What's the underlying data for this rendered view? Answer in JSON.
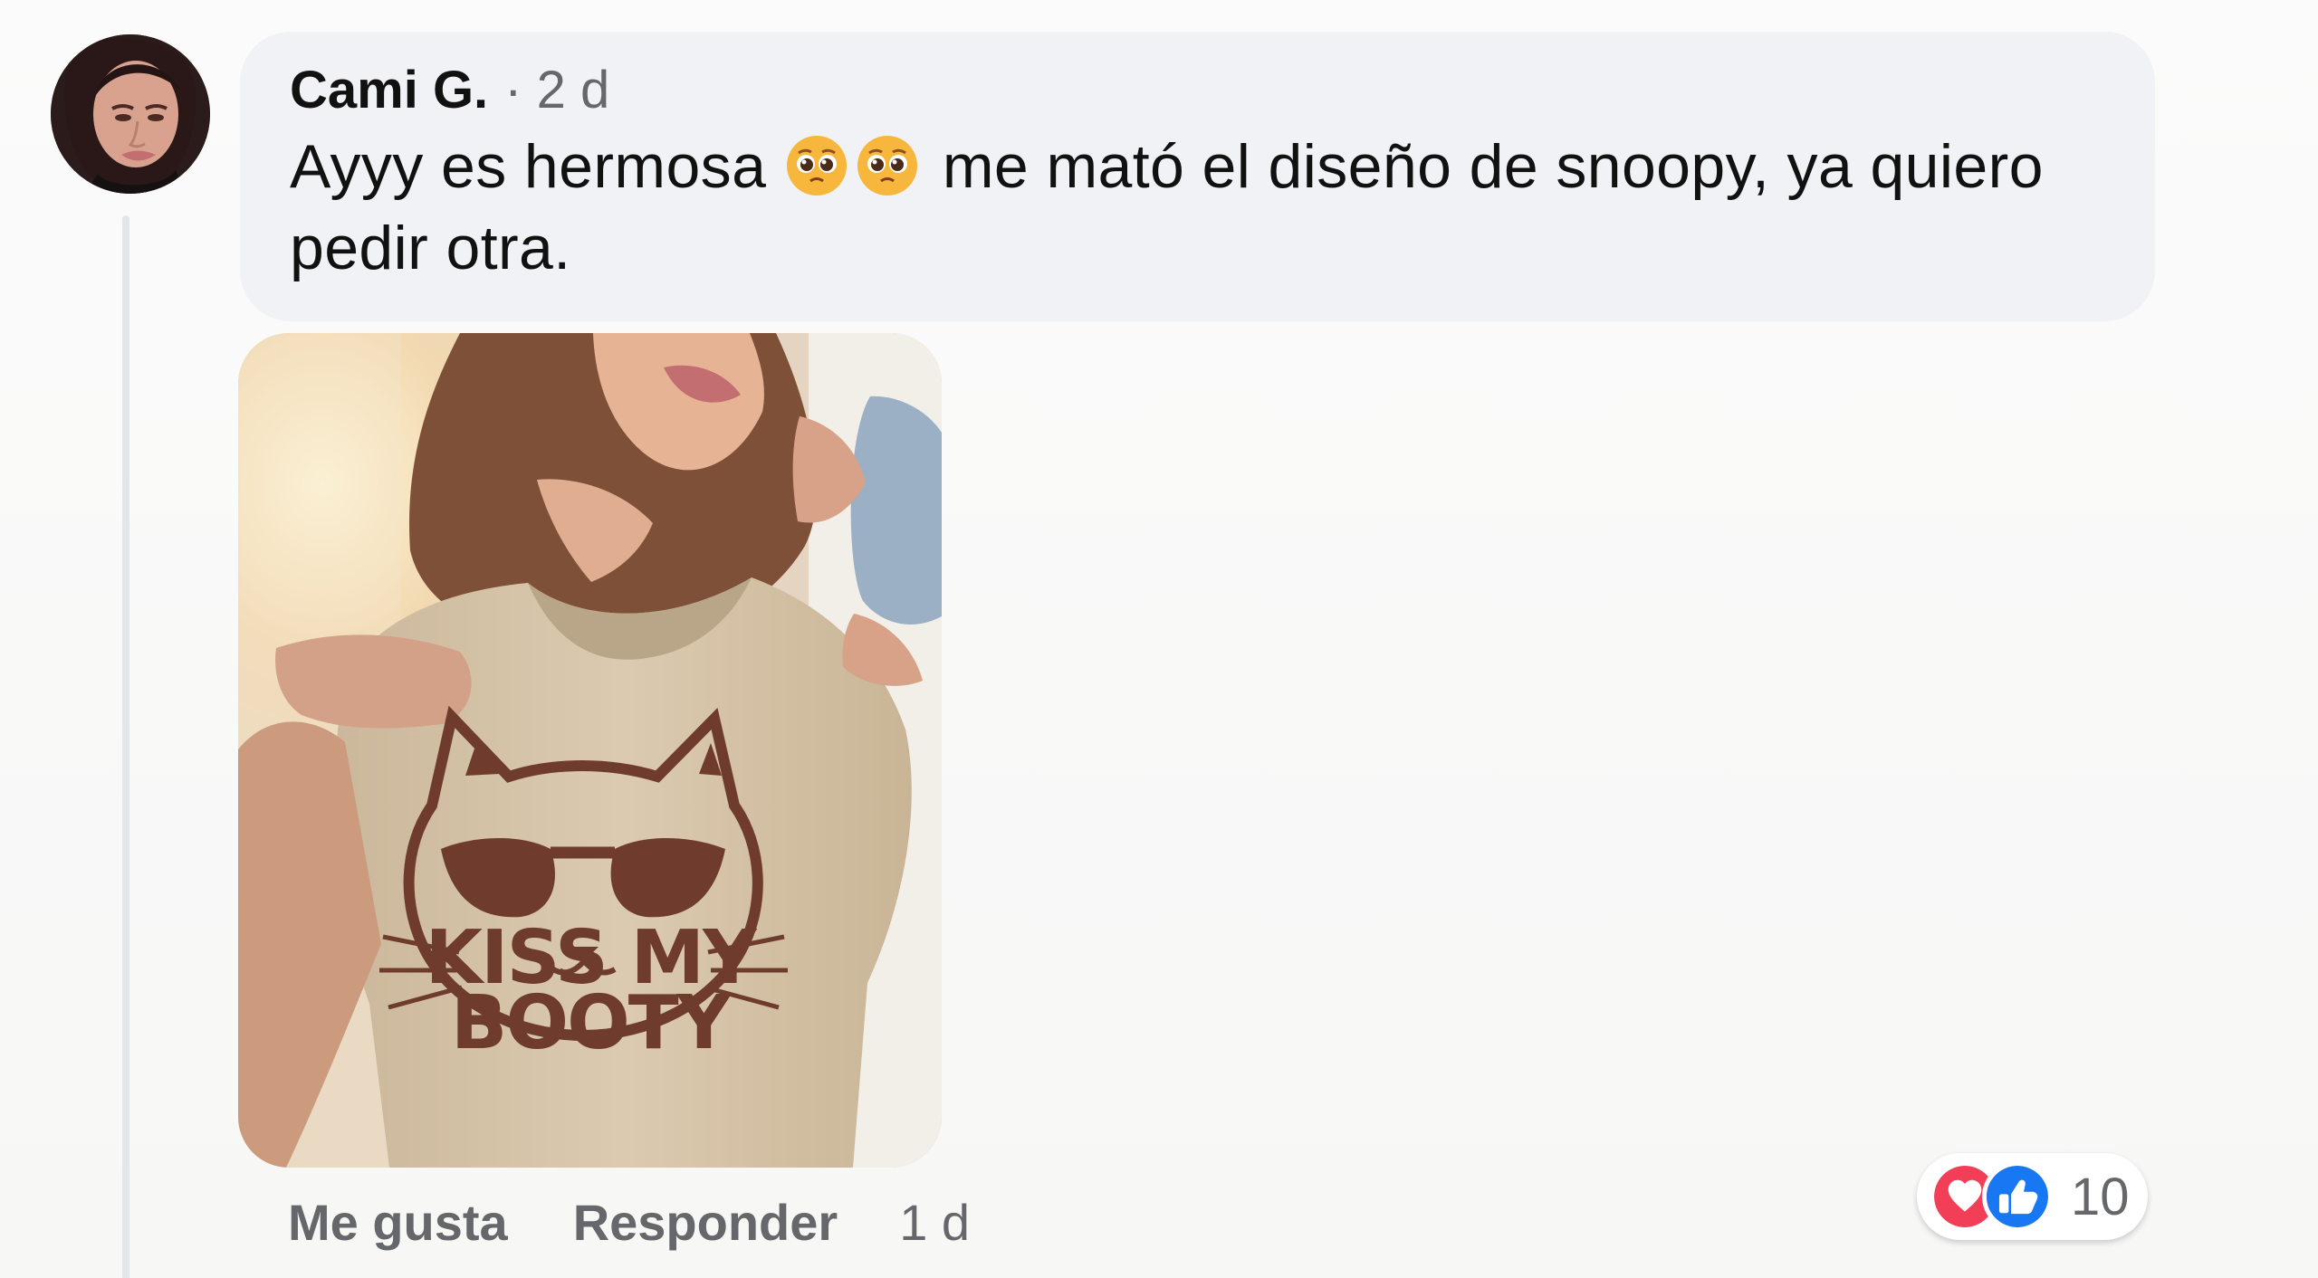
{
  "comment": {
    "author": "Cami G.",
    "separator": "·",
    "time": "2 d",
    "text_start": "Ayyy es hermosa",
    "text_end": "me mató el diseño de snoopy, ya quiero pedir otra.",
    "emoji_names": [
      "pleading-face-icon",
      "pleading-face-icon"
    ]
  },
  "photo": {
    "shirt_line1": "KISS MY",
    "shirt_line2": "BOOTY"
  },
  "actions": {
    "like_label": "Me gusta",
    "reply_label": "Responder",
    "time": "1 d"
  },
  "reactions": {
    "icons": [
      "heart-reaction-icon",
      "like-reaction-icon"
    ],
    "count": "10"
  },
  "colors": {
    "bubble": "#f0f2f5",
    "secondary_text": "#65676b",
    "heart": "#f33e58",
    "like": "#1877f2"
  }
}
